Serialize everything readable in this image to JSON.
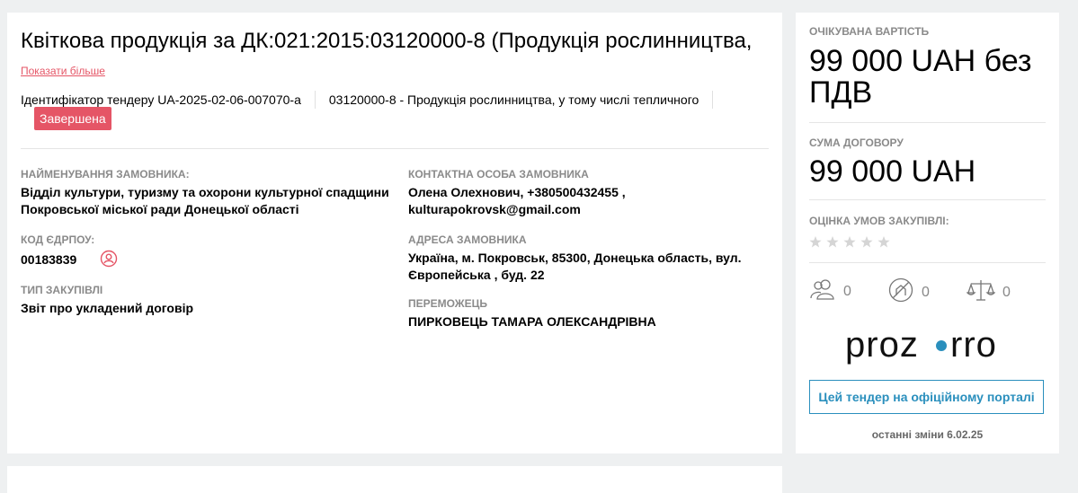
{
  "tender": {
    "title": "Квіткова продукція за ДК:021:2015:03120000-8 (Продукція рослинництва,",
    "show_more": "Показати більше",
    "identifier": "Ідентифікатор тендеру UA-2025-02-06-007070-a",
    "classification": "03120000-8 - Продукція рослинництва, у тому числі тепличного",
    "status": "Завершена"
  },
  "fields": {
    "customer_name_label": "НАЙМЕНУВАННЯ ЗАМОВНИКА:",
    "customer_name_line1": "Відділ культури, туризму та охорони культурної спадщини",
    "customer_name_line2": "Покровської міської ради Донецької області",
    "edrpou_label": "КОД ЄДРПОУ:",
    "edrpou_value": "00183839",
    "procurement_type_label": "ТИП ЗАКУПІВЛІ",
    "procurement_type_value": "Звіт про укладений договір",
    "contact_label": "КОНТАКТНА ОСОБА ЗАМОВНИКА",
    "contact_line1": "Олена Олехнович, +380500432455 ,",
    "contact_line2": "kulturapokrovsk@gmail.com",
    "address_label": "АДРЕСА ЗАМОВНИКА",
    "address_line1": "Україна, м. Покровськ, 85300, Донецька область, вул.",
    "address_line2": "Європейська , буд. 22",
    "winner_label": "ПЕРЕМОЖЕЦЬ",
    "winner_value": "ПИРКОВЕЦЬ ТАМАРА ОЛЕКСАНДРІВНА"
  },
  "side": {
    "expected_label": "ОЧІКУВАНА ВАРТІСТЬ",
    "expected_line1": "99 000 UAH без",
    "expected_line2": "ПДВ",
    "contract_label": "СУМА ДОГОВОРУ",
    "contract_value": "99 000 UAH",
    "rating_label": "ОЦІНКА УМОВ ЗАКУПІВЛІ:",
    "rating_value": 0,
    "stat_participants": "0",
    "stat_complaints": "0",
    "stat_appeals": "0",
    "logo_text_left": "proz",
    "logo_text_right": "rro",
    "portal_button": "Цей тендер на офіційному порталі",
    "last_change": "останні зміни 6.02.25"
  },
  "colors": {
    "accent_red": "#e55566",
    "link_blue": "#2a8fbd",
    "logo_dot": "#2a8fbd"
  }
}
